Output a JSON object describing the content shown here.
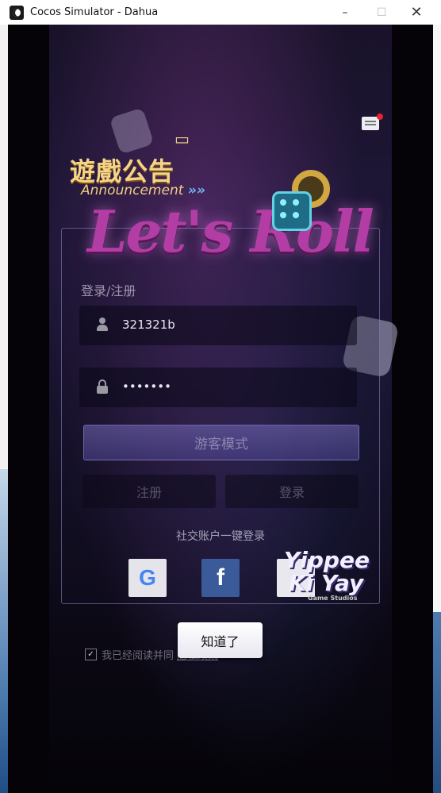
{
  "window": {
    "title": "Cocos Simulator - Dahua",
    "minimize_glyph": "–",
    "maximize_glyph": "☐",
    "close_glyph": "✕"
  },
  "announcement": {
    "title": "遊戲公告",
    "subtitle": "Announcement",
    "arrows": "»»",
    "icon": "announcement-icon"
  },
  "mailbox": {
    "icon": "mail-icon",
    "has_unread": true
  },
  "logo": {
    "text": "Let's Roll"
  },
  "login": {
    "title": "登录/注册",
    "username_value": "321321b",
    "password_value": "•••••••",
    "guest_label": "游客模式",
    "register_label": "注册",
    "login_label": "登录",
    "social_title": "社交账户一键登录"
  },
  "social": {
    "google_glyph": "G",
    "facebook_glyph": "f"
  },
  "studio": {
    "line1": "Yippee",
    "line2": "Ki Yay",
    "line3": "Game Studios"
  },
  "dialog": {
    "ok_label": "知道了"
  },
  "agreement": {
    "checked": true,
    "prefix": "我已经阅读并同",
    "policy": "隐私政策"
  },
  "colors": {
    "accent_logo": "#b23ea5",
    "announcement_gold": "#f3d58a",
    "facebook_blue": "#3b5a9a",
    "unread_red": "#e8232f"
  }
}
